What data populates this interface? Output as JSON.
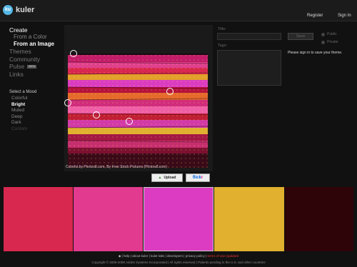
{
  "header": {
    "logo_badge": "ku",
    "logo_text": "kuler",
    "register_label": "Register",
    "signin_label": "Sign In"
  },
  "sidebar": {
    "create": "Create",
    "from_color": "From a Color",
    "from_image": "From an Image",
    "themes": "Themes",
    "community": "Community",
    "pulse": "Pulse",
    "pulse_badge": "BETA",
    "links": "Links",
    "mood_title": "Select a Mood",
    "moods": [
      "Colorful",
      "Bright",
      "Muted",
      "Deep",
      "Dark",
      "Custom"
    ],
    "selected_mood": "Bright"
  },
  "photo": {
    "caption": "Colorful by Photos8.com, By Free Stock Pictures (Photos8.com)",
    "upload_label": "Upload",
    "flickr_label_a": "flick",
    "flickr_label_b": "r"
  },
  "form": {
    "title_label": "Title:",
    "tags_label": "Tags:",
    "save_label": "Save",
    "public_label": "Public",
    "private_label": "Private",
    "signin_message": "Please sign in to save your theme."
  },
  "swatches": [
    {
      "color": "#d8284f"
    },
    {
      "color": "#e23a8e"
    },
    {
      "color": "#db3cc1",
      "selected": true
    },
    {
      "color": "#e0b02e"
    },
    {
      "color": "#2e0408"
    }
  ],
  "footer": {
    "links": [
      "help",
      "about kuler",
      "kuler labs",
      "developers",
      "privacy policy"
    ],
    "terms": "terms of use (updated",
    "copyright": "Copyright © 2006-2008 Adobe Systems Incorporated | All rights reserved | Patents pending in the U.S. and other countries"
  }
}
